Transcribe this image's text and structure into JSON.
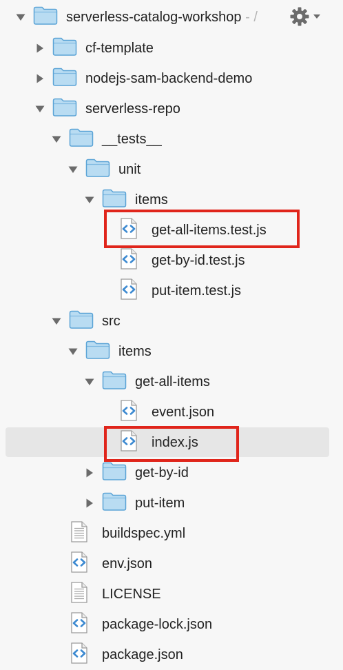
{
  "tree": {
    "root": {
      "label": "serverless-catalog-workshop",
      "suffix": " - /"
    },
    "cf_template": "cf-template",
    "nodejs_sam": "nodejs-sam-backend-demo",
    "serverless_repo": "serverless-repo",
    "tests": "__tests__",
    "unit": "unit",
    "tests_items": "items",
    "test_get_all": "get-all-items.test.js",
    "test_get_by_id": "get-by-id.test.js",
    "test_put_item": "put-item.test.js",
    "src": "src",
    "src_items": "items",
    "get_all_items": "get-all-items",
    "event_json": "event.json",
    "index_js": "index.js",
    "get_by_id": "get-by-id",
    "put_item": "put-item",
    "buildspec": "buildspec.yml",
    "env_json": "env.json",
    "license": "LICENSE",
    "package_lock": "package-lock.json",
    "package_json": "package.json"
  },
  "selected_item": "index.js",
  "highlighted_items": [
    "get-all-items.test.js",
    "index.js"
  ],
  "colors": {
    "folder_fill": "#b9dcf2",
    "folder_stroke": "#5aa3d6",
    "highlight": "#e0251b",
    "selected_row": "#e6e6e6",
    "code_icon": "#3d8ad1"
  },
  "icons": {
    "gear": "gear-icon",
    "folder": "folder-icon",
    "code_file": "code-file-icon",
    "text_file": "text-file-icon",
    "expanded": "triangle-down-icon",
    "collapsed": "triangle-right-icon"
  }
}
